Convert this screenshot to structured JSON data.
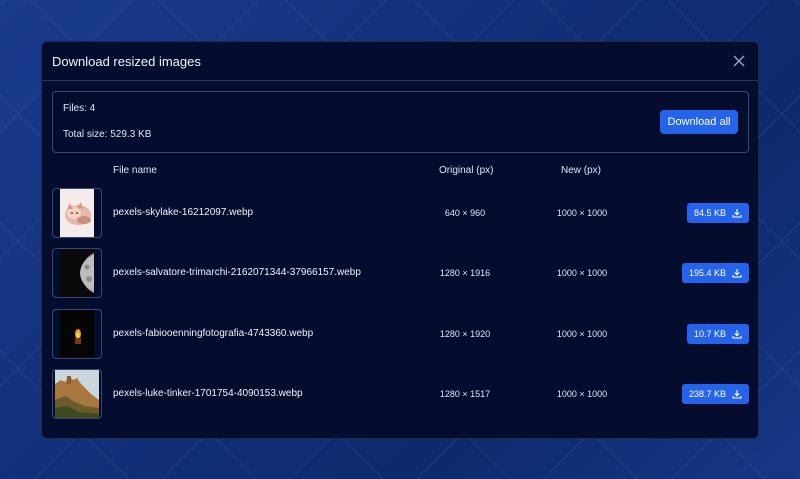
{
  "modal": {
    "title": "Download resized images",
    "files_label": "Files: 4",
    "total_size_label": "Total size: 529.3 KB",
    "download_all_label": "Download all"
  },
  "columns": {
    "file_name": "File name",
    "original": "Original (px)",
    "new": "New (px)"
  },
  "rows": [
    {
      "name": "pexels-skylake-16212097.webp",
      "original": "640 × 960",
      "new": "1000 × 1000",
      "size": "84.5 KB",
      "thumb": "cat-photo"
    },
    {
      "name": "pexels-salvatore-trimarchi-2162071344-37966157.webp",
      "original": "1280 × 1916",
      "new": "1000 × 1000",
      "size": "195.4 KB",
      "thumb": "moon-photo"
    },
    {
      "name": "pexels-fabiooenningfotografia-4743360.webp",
      "original": "1280 × 1920",
      "new": "1000 × 1000",
      "size": "10.7 KB",
      "thumb": "candle-photo"
    },
    {
      "name": "pexels-luke-tinker-1701754-4090153.webp",
      "original": "1280 × 1517",
      "new": "1000 × 1000",
      "size": "238.7 KB",
      "thumb": "castle-photo"
    }
  ],
  "colors": {
    "accent": "#2563eb",
    "modal_bg": "#050d2e"
  }
}
